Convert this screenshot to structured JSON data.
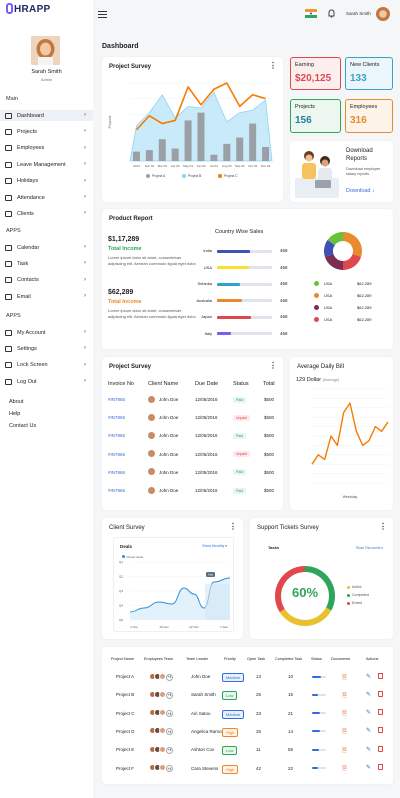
{
  "app": {
    "logo": "HRAPP"
  },
  "user": {
    "name": "Sarah Smith",
    "role": "Admin"
  },
  "sidebar": {
    "section_main": "Main",
    "section_apps": "APPS",
    "section_apps2": "APPS",
    "items": [
      {
        "label": "Dashboard"
      },
      {
        "label": "Projects"
      },
      {
        "label": "Employees"
      },
      {
        "label": "Leave Management"
      },
      {
        "label": "Holidays"
      },
      {
        "label": "Attendance"
      },
      {
        "label": "Clients"
      }
    ],
    "apps": [
      {
        "label": "Calendar"
      },
      {
        "label": "Task"
      },
      {
        "label": "Contacts"
      },
      {
        "label": "Email"
      }
    ],
    "apps2": [
      {
        "label": "My Account"
      },
      {
        "label": "Settings"
      },
      {
        "label": "Lock Screen"
      },
      {
        "label": "Log Out"
      }
    ],
    "links": [
      {
        "label": "About"
      },
      {
        "label": "Help"
      },
      {
        "label": "Contact Us"
      }
    ]
  },
  "header": {
    "user_name": "Sarah Smith"
  },
  "page": {
    "title": "Dashboard"
  },
  "stats": [
    {
      "label": "Earning",
      "value": "$20,125",
      "color": "#e0484f"
    },
    {
      "label": "New Clients",
      "value": "133",
      "color": "#3aa0c8"
    },
    {
      "label": "Projects",
      "value": "156",
      "color": "#2ea55a"
    },
    {
      "label": "Employees",
      "value": "316",
      "color": "#e88a2e"
    }
  ],
  "download": {
    "title": "Download Reports",
    "desc": "Download employee salary reports",
    "link": "Download"
  },
  "project_survey": {
    "title": "Project Survey",
    "ylabel": "Projects",
    "chart_data": {
      "type": "bar+line",
      "categories": [
        "2013",
        "Feb 03",
        "Mar 03",
        "Apr 03",
        "May 03",
        "Jun 03",
        "Jul 03",
        "Aug 03",
        "Sep 03",
        "Oct 03",
        "Nov 03"
      ],
      "series": [
        {
          "name": "Project A",
          "color": "#9aa0a6",
          "values": [
            12,
            14,
            28,
            16,
            52,
            62,
            8,
            22,
            30,
            48,
            18
          ]
        },
        {
          "name": "Project B",
          "color": "#8fd3f4",
          "values": [
            45,
            62,
            85,
            55,
            70,
            68,
            88,
            50,
            62,
            65,
            78
          ]
        },
        {
          "name": "Project C",
          "color": "#f57c00",
          "values": [
            40,
            58,
            48,
            52,
            95,
            72,
            92,
            100,
            70,
            85,
            80
          ]
        }
      ],
      "ylim": [
        0,
        100
      ]
    }
  },
  "product_report": {
    "title": "Product Report",
    "total1": "$1,17,289",
    "label1": "Total Income",
    "desc1": "Lorem ipsum dolor sit amet, consectetuer adipiscing elit. Aenean commodo ligula eget dolor.",
    "total2": "$62,289",
    "label2": "Total Income",
    "desc2": "Lorem ipsum dolor sit amet, consectetuer adipiscing elit. Aenean commodo ligula eget dolor.",
    "country_title": "Country Wise Sales",
    "countries": [
      {
        "name": "India",
        "value": "468",
        "pct": 0.6,
        "color": "#3f51b5"
      },
      {
        "name": "USA",
        "value": "468",
        "pct": 0.58,
        "color": "#fbe12d"
      },
      {
        "name": "Srilanka",
        "value": "468",
        "pct": 0.42,
        "color": "#2ea5c8"
      },
      {
        "name": "Australia",
        "value": "468",
        "pct": 0.45,
        "color": "#e88a2e"
      },
      {
        "name": "Japan",
        "value": "468",
        "pct": 0.62,
        "color": "#e0484f"
      },
      {
        "name": "Italy",
        "value": "468",
        "pct": 0.25,
        "color": "#7b5cf5"
      }
    ],
    "legend": [
      {
        "label": "USA",
        "value": "$62,289",
        "color": "#67c23a"
      },
      {
        "label": "USA",
        "value": "$62,289",
        "color": "#e88a2e"
      },
      {
        "label": "USA",
        "value": "$62,289",
        "color": "#7b2d52"
      },
      {
        "label": "USA",
        "value": "$62,289",
        "color": "#e0484f"
      }
    ],
    "donut": [
      {
        "color": "#e88a2e",
        "value": 30
      },
      {
        "color": "#e0484f",
        "value": 20
      },
      {
        "color": "#7b2d52",
        "value": 20
      },
      {
        "color": "#3f51b5",
        "value": 15
      },
      {
        "color": "#67c23a",
        "value": 15
      }
    ]
  },
  "invoice_survey": {
    "title": "Project Survey",
    "cols": [
      "Invoice No",
      "Client Name",
      "Due Date",
      "Status",
      "Total"
    ],
    "rows": [
      {
        "inv": "#IN7865",
        "client": "John Doe",
        "due": "12/05/2016",
        "status": "Paid",
        "total": "$500"
      },
      {
        "inv": "#IN7865",
        "client": "John Doe",
        "due": "12/05/2016",
        "status": "Unpaid",
        "total": "$500"
      },
      {
        "inv": "#IN7865",
        "client": "John Doe",
        "due": "12/05/2016",
        "status": "Paid",
        "total": "$500"
      },
      {
        "inv": "#IN7865",
        "client": "John Doe",
        "due": "12/05/2016",
        "status": "Unpaid",
        "total": "$500"
      },
      {
        "inv": "#IN7865",
        "client": "John Doe",
        "due": "12/05/2016",
        "status": "Paid",
        "total": "$500"
      },
      {
        "inv": "#IN7865",
        "client": "John Doe",
        "due": "12/05/2016",
        "status": "Paid",
        "total": "$500"
      }
    ]
  },
  "daily_bill": {
    "title": "Average Daily Bill",
    "value": "129 Dollar",
    "sub": "(Average)",
    "xlabel": "Weekday",
    "chart_data": {
      "type": "line",
      "color": "#f57c00",
      "values": [
        20,
        30,
        25,
        50,
        40,
        75,
        85,
        55,
        40,
        45,
        60,
        55,
        65
      ]
    }
  },
  "client_survey": {
    "title": "Client Survey",
    "inner_title": "Deals",
    "link": "Show Monthly",
    "legend": "Closed deals",
    "tooltip": "Add",
    "yticks": [
      "Q1",
      "Q2",
      "Q3",
      "Q4",
      "Q5"
    ],
    "xticks": [
      "1 Nov",
      "15 Nov",
      "22 Nov",
      "1 Dec"
    ]
  },
  "support": {
    "title": "Support Tickets Survey",
    "inner_title": "Tasks",
    "link": "Show This month",
    "percent": "60%",
    "pct_value": 60,
    "legend": [
      {
        "label": "Active",
        "color": "#e8c22e"
      },
      {
        "label": "Completed",
        "color": "#2ea55a"
      },
      {
        "label": "Ended",
        "color": "#e0484f"
      }
    ]
  },
  "projects_table": {
    "cols": [
      "Project Name",
      "Employees Team",
      "Team Leader",
      "Priority",
      "Open Task",
      "Completed Task",
      "Status",
      "Documents",
      "Actions"
    ],
    "rows": [
      {
        "name": "Project A",
        "extra": "+4",
        "leader": "John Doe",
        "priority": "Medium",
        "open": "13",
        "done": "10",
        "progress": 0.65
      },
      {
        "name": "Project B",
        "extra": "+4",
        "leader": "Sarah Smith",
        "priority": "Low",
        "open": "25",
        "done": "15",
        "progress": 0.4
      },
      {
        "name": "Project C",
        "extra": "+4",
        "leader": "Airi Satou",
        "priority": "Medium",
        "open": "33",
        "done": "21",
        "progress": 0.55
      },
      {
        "name": "Project D",
        "extra": "+4",
        "leader": "Angelica Ramos",
        "priority": "High",
        "open": "25",
        "done": "14",
        "progress": 0.6
      },
      {
        "name": "Project E",
        "extra": "+4",
        "leader": "Ashton Cox",
        "priority": "Low",
        "open": "11",
        "done": "55",
        "progress": 0.5
      },
      {
        "name": "Project F",
        "extra": "+4",
        "leader": "Cara Stevens",
        "priority": "High",
        "open": "42",
        "done": "22",
        "progress": 0.45
      }
    ]
  }
}
